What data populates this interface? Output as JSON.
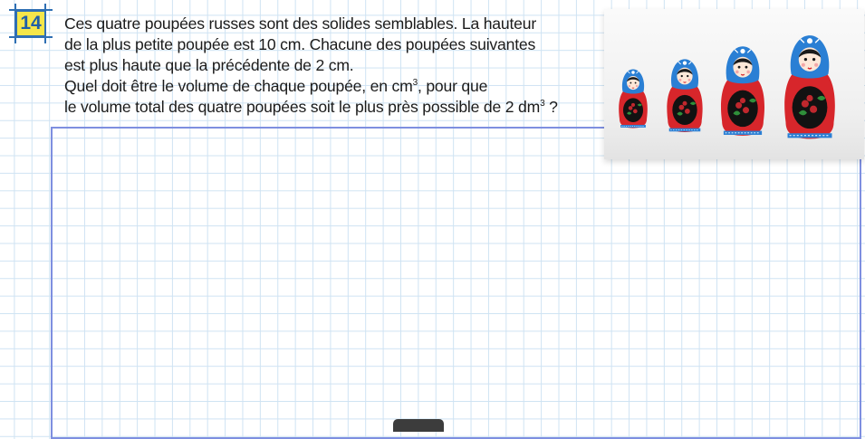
{
  "exercise": {
    "number": "14",
    "lines": [
      "Ces quatre poupées russes sont des solides semblables. La hauteur",
      "de la plus petite poupée est 10 cm. Chacune des poupées suivantes",
      "est plus haute que la précédente de 2 cm."
    ],
    "line4_before": "Quel doit être le volume de chaque poupée, en cm",
    "line4_sup": "3",
    "line4_after": ", pour que",
    "line5_before": "le volume total des quatre poupées soit le plus près possible de 2 dm",
    "line5_sup": "3",
    "line5_after": " ?"
  },
  "image": {
    "icon": "matryoshka-dolls-icon",
    "colors": {
      "headscarf": "#2a7fd4",
      "body": "#d42a2a",
      "apron": "#1a1a1a",
      "background": "#f2f2f2"
    }
  },
  "colors": {
    "grid": "#cfe3f3",
    "answer_border": "#7e8fe0",
    "number_bg": "#f5e64a",
    "number_fg": "#1f5fa8"
  }
}
